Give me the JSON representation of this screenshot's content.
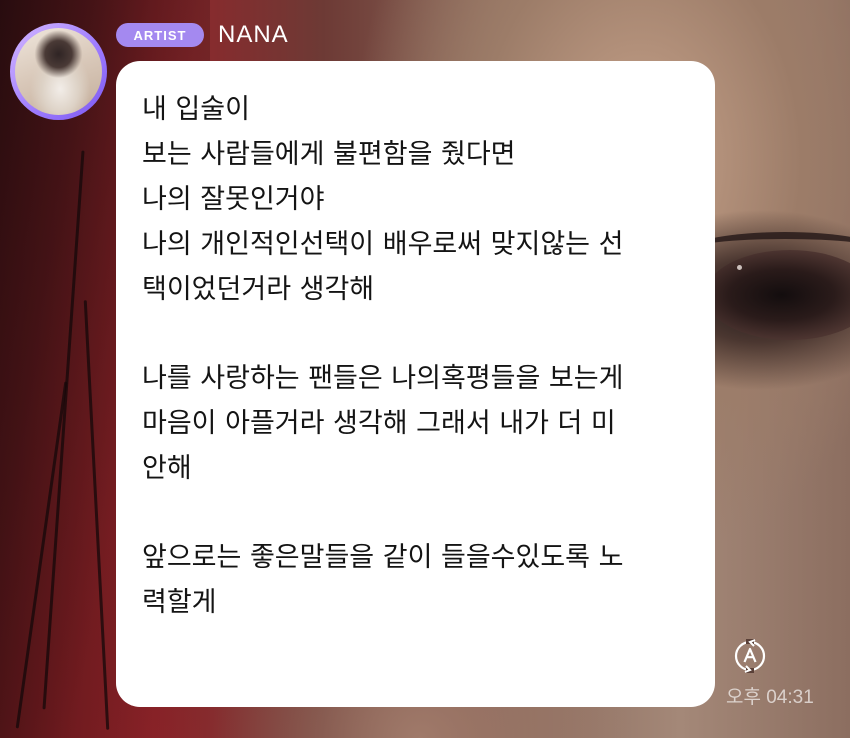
{
  "sender": {
    "badge": "ARTIST",
    "name": "NANA"
  },
  "message": {
    "lines": [
      "내 입술이",
      "보는 사람들에게 불편함을 줬다면",
      "나의 잘못인거야",
      "나의 개인적인선택이 배우로써 맞지않는 선",
      "택이었던거라 생각해",
      "",
      "나를 사랑하는 팬들은 나의혹평들을 보는게",
      "마음이 아플거라 생각해 그래서 내가 더 미",
      "안해",
      "",
      "앞으로는 좋은말들을 같이 들을수있도록 노",
      "력할게"
    ],
    "time": "오후 04:31"
  },
  "icons": {
    "translate": "auto-translate-icon"
  },
  "colors": {
    "badge": "#a489f0",
    "avatar_ring": "#9f7dff",
    "bubble": "#ffffff"
  }
}
